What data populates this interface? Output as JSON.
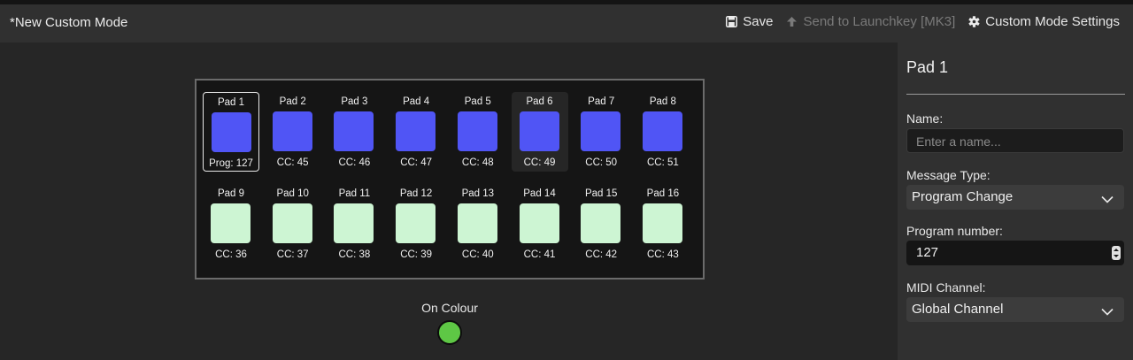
{
  "header": {
    "mode_title": "*New Custom Mode",
    "save_label": "Save",
    "send_label": "Send to Launchkey [MK3]",
    "settings_label": "Custom Mode Settings"
  },
  "colors": {
    "pad_blue": "#5055f5",
    "pad_mint": "#cdf5d3",
    "on_colour": "#5ec745"
  },
  "pads": [
    {
      "name": "Pad 1",
      "message": "Prog: 127",
      "color": "#5055f5",
      "selected": true
    },
    {
      "name": "Pad 2",
      "message": "CC: 45",
      "color": "#5055f5"
    },
    {
      "name": "Pad 3",
      "message": "CC: 46",
      "color": "#5055f5"
    },
    {
      "name": "Pad 4",
      "message": "CC: 47",
      "color": "#5055f5"
    },
    {
      "name": "Pad 5",
      "message": "CC: 48",
      "color": "#5055f5"
    },
    {
      "name": "Pad 6",
      "message": "CC: 49",
      "color": "#5055f5",
      "hover": true
    },
    {
      "name": "Pad 7",
      "message": "CC: 50",
      "color": "#5055f5"
    },
    {
      "name": "Pad 8",
      "message": "CC: 51",
      "color": "#5055f5"
    },
    {
      "name": "Pad 9",
      "message": "CC: 36",
      "color": "#cdf5d3"
    },
    {
      "name": "Pad 10",
      "message": "CC: 37",
      "color": "#cdf5d3"
    },
    {
      "name": "Pad 11",
      "message": "CC: 38",
      "color": "#cdf5d3"
    },
    {
      "name": "Pad 12",
      "message": "CC: 39",
      "color": "#cdf5d3"
    },
    {
      "name": "Pad 13",
      "message": "CC: 40",
      "color": "#cdf5d3"
    },
    {
      "name": "Pad 14",
      "message": "CC: 41",
      "color": "#cdf5d3"
    },
    {
      "name": "Pad 15",
      "message": "CC: 42",
      "color": "#cdf5d3"
    },
    {
      "name": "Pad 16",
      "message": "CC: 43",
      "color": "#cdf5d3"
    }
  ],
  "on_colour": {
    "label": "On Colour"
  },
  "panel": {
    "title": "Pad 1",
    "name_label": "Name:",
    "name_placeholder": "Enter a name...",
    "message_type_label": "Message Type:",
    "message_type_value": "Program Change",
    "program_number_label": "Program number:",
    "program_number_value": "127",
    "midi_channel_label": "MIDI Channel:",
    "midi_channel_value": "Global Channel"
  }
}
